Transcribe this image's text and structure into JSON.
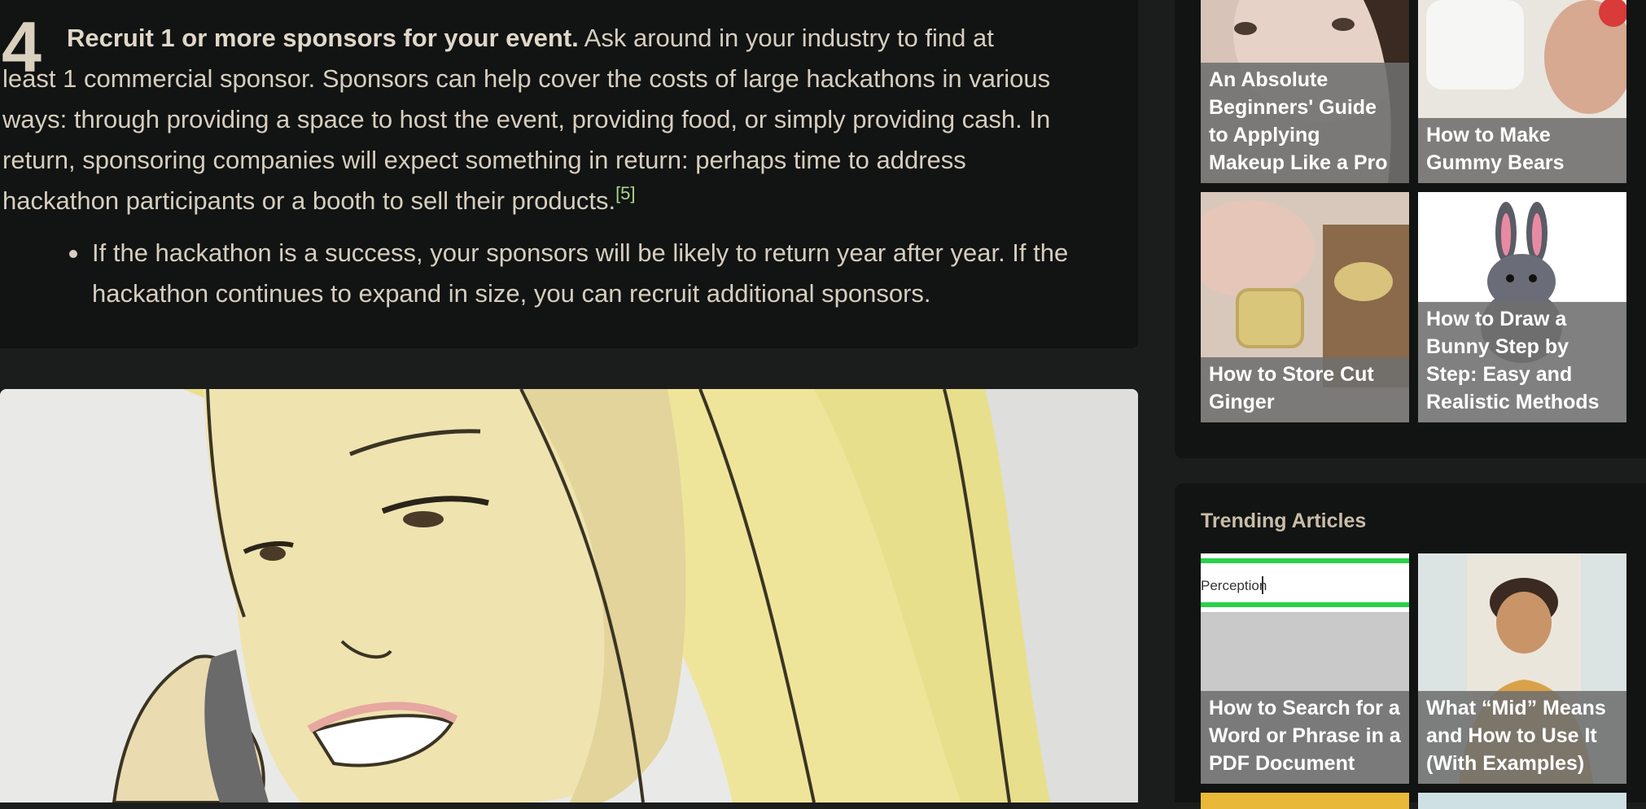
{
  "step": {
    "number": "4",
    "bold_text": "Recruit 1 or more sponsors for your event.",
    "body_text": " Ask around in your industry to find at least 1 commercial sponsor. Sponsors can help cover the costs of large hackathons in various ways: through providing a space to host the event, providing food, or simply providing cash. In return, sponsoring companies will expect something in return: perhaps time to address hackathon participants or a booth to sell their products.",
    "citation": "[5]",
    "bullets": [
      "If the hackathon is a success, your sponsors will be likely to return year after year. If the hackathon continues to expand in size, you can recruit additional sponsors."
    ]
  },
  "sidebar": {
    "related": [
      {
        "title": "An Absolute Beginners' Guide to Applying Makeup Like a Pro"
      },
      {
        "title": "How to Make Gummy Bears"
      },
      {
        "title": "How to Store Cut Ginger"
      },
      {
        "title": "How to Draw a Bunny Step by Step: Easy and Realistic Methods"
      }
    ],
    "trending_heading": "Trending Articles",
    "trending": [
      {
        "title": "How to Search for a Word or Phrase in a PDF Document",
        "thumb_text": "Perception"
      },
      {
        "title": "What “Mid” Means and How to Use It (With Examples)"
      }
    ]
  },
  "colors": {
    "page_bg": "#1b1c1c",
    "card_bg": "#121313",
    "text": "#d6cebe",
    "citation": "#a9d88a",
    "caption_overlay": "#6e6e6e"
  }
}
